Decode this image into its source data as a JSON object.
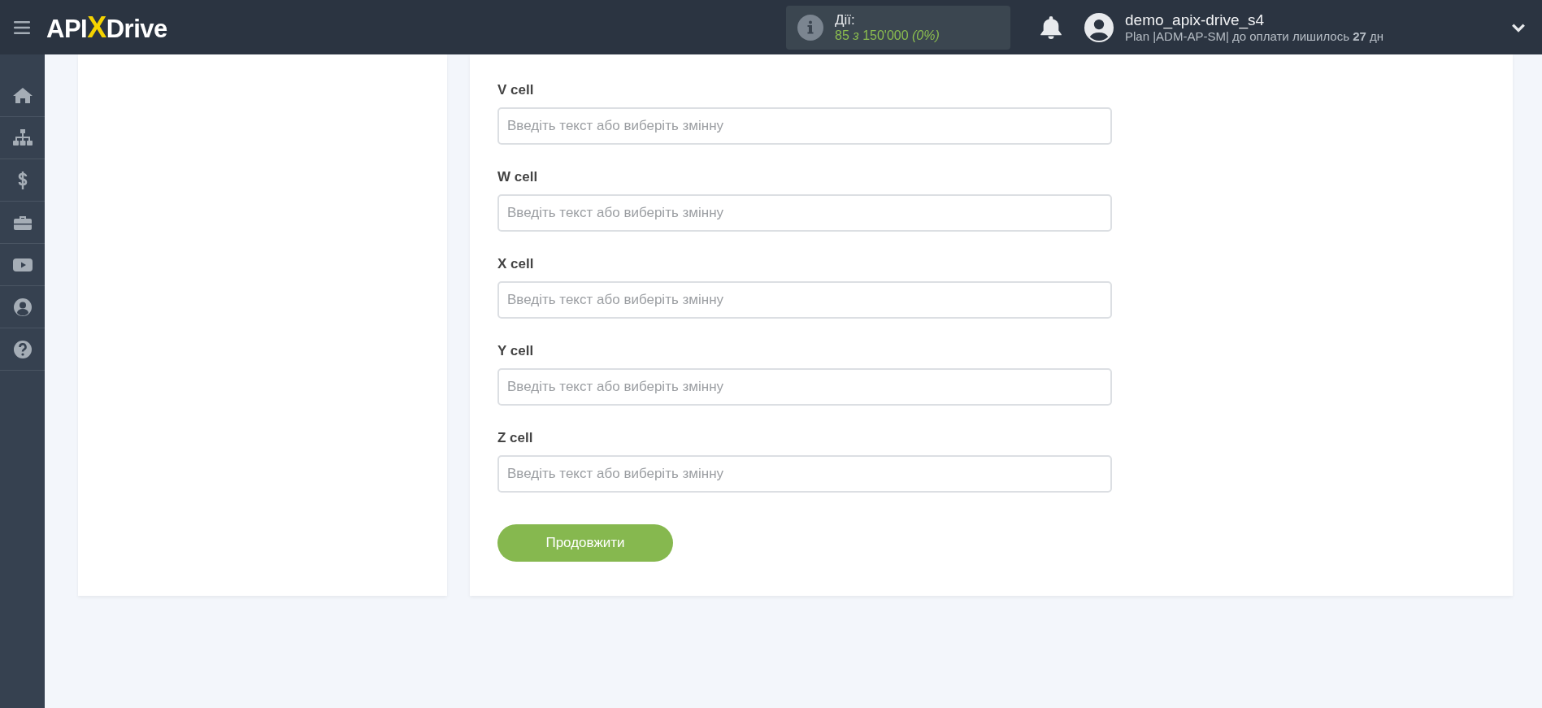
{
  "header": {
    "logo": [
      "API",
      "X",
      "Drive"
    ],
    "actions": {
      "title": "Дії:",
      "usage": "85 *з* 150'000 *(0%)*"
    },
    "user": {
      "name": "demo_apix-drive_s4",
      "plan": "Plan |ADM-AP-SM| до оплати лишилось **27** дн"
    }
  },
  "sidebar": {
    "items": [
      {
        "kind": "home"
      },
      {
        "kind": "sitemap"
      },
      {
        "kind": "dollar"
      },
      {
        "kind": "briefcase"
      },
      {
        "kind": "video"
      },
      {
        "kind": "user"
      },
      {
        "kind": "help"
      }
    ]
  },
  "form": {
    "fields": [
      {
        "label": "V cell",
        "placeholder": "Введіть текст або виберіть змінну"
      },
      {
        "label": "W cell",
        "placeholder": "Введіть текст або виберіть змінну"
      },
      {
        "label": "X cell",
        "placeholder": "Введіть текст або виберіть змінну"
      },
      {
        "label": "Y cell",
        "placeholder": "Введіть текст або виберіть змінну"
      },
      {
        "label": "Z cell",
        "placeholder": "Введіть текст або виберіть змінну"
      }
    ],
    "button": "Продовжити"
  }
}
